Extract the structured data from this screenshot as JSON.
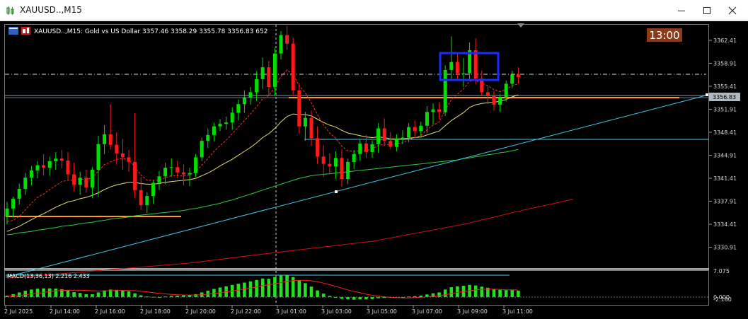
{
  "window": {
    "title": "XAUUSD..,M15",
    "buttons": {
      "minimize": "minimize-icon",
      "maximize": "maximize-icon",
      "close": "close-icon"
    }
  },
  "chart": {
    "info_line": "XAUUSD..,M15:  Gold vs US Dollar  3357.46 3358.29 3355.78 3356.83  652",
    "timer": "13:00",
    "current_price_label": "3356.83",
    "colors": {
      "bull": "#00e000",
      "bear": "#ff1a1a",
      "ma_fast": "#ff3030",
      "ma_slow": "#e8e070",
      "ma_green": "#2ecc40",
      "ma_red": "#d01010",
      "trend": "#40c8e8",
      "orange": "#ff9a1a",
      "box": "#1a2cff",
      "timer_bg": "#8b3a1a"
    }
  },
  "chart_data": {
    "type": "candlestick",
    "price_ticks": [
      "3362.41",
      "3358.91",
      "3355.41",
      "3351.91",
      "3348.41",
      "3344.91",
      "3341.41",
      "3337.91",
      "3334.41",
      "3330.91"
    ],
    "macd_label": "MACD(13,36,13) 2.216 2.433",
    "macd_ticks": [
      "7.075",
      "0.000",
      "-2.180"
    ],
    "time_labels": [
      "2 Jul 2025",
      "2 Jul 14:00",
      "2 Jul 16:00",
      "2 Jul 18:00",
      "2 Jul 20:00",
      "2 Jul 22:00",
      "3 Jul 01:00",
      "3 Jul 03:00",
      "3 Jul 05:00",
      "3 Jul 07:00",
      "3 Jul 09:00",
      "3 Jul 11:00"
    ],
    "ohlc": [
      [
        3335.6,
        3337.8,
        3334.4,
        3336.8
      ],
      [
        3336.8,
        3338.6,
        3335.4,
        3338.3
      ],
      [
        3338.3,
        3340.6,
        3337.4,
        3339.8
      ],
      [
        3339.8,
        3342.2,
        3338.9,
        3341.5
      ],
      [
        3341.5,
        3343.3,
        3340.3,
        3342.6
      ],
      [
        3342.6,
        3344.0,
        3341.4,
        3343.4
      ],
      [
        3343.4,
        3345.1,
        3341.8,
        3343.0
      ],
      [
        3343.0,
        3344.7,
        3341.8,
        3344.0
      ],
      [
        3344.0,
        3345.4,
        3342.7,
        3344.4
      ],
      [
        3344.4,
        3345.7,
        3342.9,
        3344.1
      ],
      [
        3344.1,
        3345.4,
        3341.2,
        3342.0
      ],
      [
        3342.0,
        3343.8,
        3339.4,
        3340.4
      ],
      [
        3340.4,
        3342.4,
        3338.9,
        3341.5
      ],
      [
        3341.5,
        3342.7,
        3339.2,
        3340.0
      ],
      [
        3340.0,
        3343.1,
        3338.4,
        3342.7
      ],
      [
        3342.7,
        3347.9,
        3338.6,
        3346.6
      ],
      [
        3346.6,
        3349.5,
        3345.1,
        3348.1
      ],
      [
        3348.1,
        3352.7,
        3345.8,
        3346.5
      ],
      [
        3346.5,
        3348.4,
        3343.5,
        3345.2
      ],
      [
        3345.2,
        3347.4,
        3342.7,
        3344.6
      ],
      [
        3344.6,
        3345.7,
        3342.4,
        3343.9
      ],
      [
        3343.9,
        3351.3,
        3338.4,
        3339.6
      ],
      [
        3339.6,
        3341.6,
        3336.6,
        3337.3
      ],
      [
        3337.3,
        3339.3,
        3336.1,
        3338.7
      ],
      [
        3338.7,
        3341.1,
        3337.5,
        3340.7
      ],
      [
        3340.7,
        3342.5,
        3339.6,
        3341.7
      ],
      [
        3341.7,
        3343.8,
        3340.5,
        3343.0
      ],
      [
        3343.0,
        3344.4,
        3341.6,
        3343.1
      ],
      [
        3343.1,
        3344.1,
        3341.4,
        3342.3
      ],
      [
        3342.3,
        3343.5,
        3340.3,
        3342.0
      ],
      [
        3342.0,
        3343.0,
        3340.2,
        3342.2
      ],
      [
        3342.2,
        3345.1,
        3341.6,
        3344.6
      ],
      [
        3344.6,
        3347.6,
        3344.0,
        3347.1
      ],
      [
        3347.1,
        3349.0,
        3346.0,
        3348.0
      ],
      [
        3348.0,
        3349.9,
        3347.0,
        3349.3
      ],
      [
        3349.3,
        3350.4,
        3348.6,
        3349.7
      ],
      [
        3349.7,
        3350.8,
        3348.8,
        3349.9
      ],
      [
        3349.9,
        3352.2,
        3348.8,
        3351.4
      ],
      [
        3351.4,
        3353.4,
        3350.2,
        3352.7
      ],
      [
        3352.7,
        3354.8,
        3351.4,
        3353.7
      ],
      [
        3353.7,
        3355.3,
        3352.6,
        3354.5
      ],
      [
        3354.5,
        3357.7,
        3353.2,
        3356.5
      ],
      [
        3356.5,
        3359.8,
        3355.0,
        3358.3
      ],
      [
        3358.3,
        3359.3,
        3354.0,
        3355.3
      ],
      [
        3355.3,
        3361.3,
        3354.0,
        3360.4
      ],
      [
        3360.4,
        3363.8,
        3359.5,
        3363.2
      ],
      [
        3363.2,
        3364.6,
        3361.0,
        3361.9
      ],
      [
        3361.9,
        3362.8,
        3354.0,
        3354.8
      ],
      [
        3354.8,
        3355.9,
        3348.2,
        3349.3
      ],
      [
        3349.3,
        3351.5,
        3347.1,
        3350.6
      ],
      [
        3350.6,
        3351.7,
        3346.3,
        3347.5
      ],
      [
        3347.5,
        3349.3,
        3343.6,
        3344.7
      ],
      [
        3344.7,
        3346.4,
        3341.6,
        3343.6
      ],
      [
        3343.6,
        3345.2,
        3342.0,
        3343.2
      ],
      [
        3343.2,
        3345.5,
        3341.3,
        3344.5
      ],
      [
        3344.5,
        3345.8,
        3340.1,
        3341.3
      ],
      [
        3341.3,
        3344.4,
        3340.5,
        3343.9
      ],
      [
        3343.9,
        3345.7,
        3342.8,
        3345.1
      ],
      [
        3345.1,
        3347.3,
        3344.1,
        3346.7
      ],
      [
        3346.7,
        3348.0,
        3344.5,
        3345.4
      ],
      [
        3345.4,
        3347.2,
        3344.5,
        3346.6
      ],
      [
        3346.6,
        3349.8,
        3345.3,
        3349.0
      ],
      [
        3349.0,
        3350.5,
        3346.3,
        3347.1
      ],
      [
        3347.1,
        3348.4,
        3345.8,
        3346.2
      ],
      [
        3346.2,
        3348.1,
        3345.5,
        3347.4
      ],
      [
        3347.4,
        3348.7,
        3346.6,
        3347.6
      ],
      [
        3347.6,
        3349.8,
        3346.9,
        3349.2
      ],
      [
        3349.2,
        3350.2,
        3347.7,
        3348.6
      ],
      [
        3348.6,
        3350.0,
        3347.6,
        3349.4
      ],
      [
        3349.4,
        3352.4,
        3348.3,
        3351.5
      ],
      [
        3351.5,
        3352.8,
        3349.6,
        3351.9
      ],
      [
        3351.9,
        3353.0,
        3350.4,
        3351.5
      ],
      [
        3351.5,
        3358.6,
        3350.9,
        3357.9
      ],
      [
        3357.9,
        3363.0,
        3356.4,
        3359.1
      ],
      [
        3359.1,
        3360.4,
        3356.4,
        3357.4
      ],
      [
        3357.4,
        3359.7,
        3355.3,
        3357.4
      ],
      [
        3357.4,
        3362.1,
        3356.3,
        3360.9
      ],
      [
        3360.9,
        3362.7,
        3355.7,
        3356.6
      ],
      [
        3356.6,
        3357.8,
        3353.9,
        3354.5
      ],
      [
        3354.5,
        3355.4,
        3352.7,
        3353.9
      ],
      [
        3353.9,
        3354.7,
        3351.7,
        3352.6
      ],
      [
        3352.6,
        3354.2,
        3351.5,
        3353.7
      ],
      [
        3353.7,
        3356.3,
        3353.1,
        3355.8
      ],
      [
        3355.8,
        3357.8,
        3355.1,
        3357.2
      ],
      [
        3357.2,
        3358.3,
        3355.8,
        3356.8
      ]
    ],
    "ma_fast": [
      3334.8,
      3335.0,
      3335.6,
      3336.6,
      3337.6,
      3338.5,
      3339.0,
      3339.7,
      3340.3,
      3340.9,
      3341.1,
      3341.1,
      3341.3,
      3341.2,
      3341.5,
      3342.5,
      3343.5,
      3343.9,
      3344.3,
      3344.4,
      3344.3,
      3343.1,
      3341.9,
      3341.1,
      3341.1,
      3341.1,
      3341.5,
      3341.8,
      3341.8,
      3341.8,
      3341.9,
      3342.5,
      3343.4,
      3344.4,
      3345.5,
      3346.4,
      3347.2,
      3348.2,
      3349.2,
      3350.2,
      3351.2,
      3352.3,
      3353.5,
      3354.0,
      3355.3,
      3356.9,
      3357.9,
      3357.2,
      3355.5,
      3354.4,
      3352.9,
      3351.1,
      3349.5,
      3348.3,
      3347.5,
      3346.3,
      3345.6,
      3345.5,
      3345.6,
      3345.6,
      3345.9,
      3346.4,
      3346.6,
      3346.5,
      3346.7,
      3346.8,
      3347.3,
      3347.6,
      3347.9,
      3348.8,
      3349.5,
      3350.0,
      3351.8,
      3353.4,
      3354.2,
      3355.0,
      3356.2,
      3356.3,
      3355.9,
      3355.5,
      3354.9,
      3354.6,
      3354.9,
      3355.5,
      3355.8
    ],
    "ma_slow": [
      3333.3,
      3333.7,
      3334.1,
      3334.6,
      3335.1,
      3335.6,
      3336.0,
      3336.5,
      3337.0,
      3337.4,
      3337.8,
      3338.0,
      3338.3,
      3338.5,
      3338.8,
      3339.2,
      3339.7,
      3340.1,
      3340.4,
      3340.6,
      3340.8,
      3340.8,
      3340.6,
      3340.5,
      3340.5,
      3340.6,
      3340.8,
      3340.9,
      3341.0,
      3341.1,
      3341.2,
      3341.4,
      3341.8,
      3342.2,
      3342.7,
      3343.3,
      3343.8,
      3344.3,
      3344.9,
      3345.5,
      3346.1,
      3346.8,
      3347.6,
      3348.2,
      3349.0,
      3350.0,
      3350.8,
      3351.2,
      3351.1,
      3351.1,
      3350.9,
      3350.4,
      3349.9,
      3349.5,
      3349.2,
      3348.7,
      3348.3,
      3348.1,
      3347.9,
      3347.7,
      3347.6,
      3347.7,
      3347.6,
      3347.4,
      3347.4,
      3347.4,
      3347.5,
      3347.6,
      3347.7,
      3348.0,
      3348.3,
      3348.6,
      3349.4,
      3350.2,
      3350.8,
      3351.4,
      3352.2,
      3352.6,
      3352.8,
      3352.9,
      3353.0,
      3353.1,
      3353.4,
      3353.8,
      3354.1
    ],
    "ma_green": [
      3332.8,
      3332.9,
      3333.1,
      3333.2,
      3333.3,
      3333.5,
      3333.6,
      3333.8,
      3333.9,
      3334.1,
      3334.2,
      3334.3,
      3334.5,
      3334.6,
      3334.7,
      3334.9,
      3335.0,
      3335.2,
      3335.3,
      3335.4,
      3335.5,
      3335.7,
      3335.8,
      3335.9,
      3336.0,
      3336.1,
      3336.2,
      3336.3,
      3336.4,
      3336.5,
      3336.7,
      3336.8,
      3337.0,
      3337.2,
      3337.4,
      3337.6,
      3337.9,
      3338.1,
      3338.4,
      3338.7,
      3339.0,
      3339.3,
      3339.6,
      3339.9,
      3340.2,
      3340.5,
      3340.8,
      3341.1,
      3341.4,
      3341.6,
      3341.8,
      3341.9,
      3342.0,
      3342.1,
      3342.2,
      3342.3,
      3342.4,
      3342.5,
      3342.6,
      3342.7,
      3342.8,
      3342.9,
      3343.0,
      3343.1,
      3343.2,
      3343.3,
      3343.4,
      3343.5,
      3343.6,
      3343.7,
      3343.8,
      3343.9,
      3344.0,
      3344.1,
      3344.2,
      3344.4,
      3344.5,
      3344.7,
      3344.8,
      3345.0,
      3345.1,
      3345.3,
      3345.4,
      3345.6,
      3345.8
    ],
    "ma_red_line": [
      [
        0,
        3326.2
      ],
      [
        30,
        3328.5
      ],
      [
        45,
        3330.2
      ],
      [
        60,
        3331.8
      ],
      [
        75,
        3334.4
      ],
      [
        85,
        3336.6
      ],
      [
        93,
        3338.2
      ]
    ],
    "macd": [
      0.5,
      1.0,
      1.6,
      2.2,
      2.6,
      2.9,
      3.0,
      3.0,
      2.9,
      2.7,
      2.3,
      1.7,
      1.4,
      1.0,
      1.0,
      1.6,
      2.3,
      2.6,
      2.5,
      2.3,
      2.0,
      1.3,
      0.6,
      0.2,
      0.1,
      0.0,
      0.2,
      0.4,
      0.5,
      0.6,
      0.7,
      1.0,
      1.6,
      2.2,
      2.8,
      3.3,
      3.7,
      4.2,
      4.6,
      5.0,
      5.4,
      5.9,
      6.4,
      6.3,
      6.9,
      7.4,
      7.5,
      6.9,
      5.7,
      4.8,
      3.6,
      2.3,
      1.2,
      0.4,
      -0.1,
      -0.6,
      -0.8,
      -0.9,
      -0.8,
      -0.8,
      -0.7,
      -0.4,
      -0.3,
      -0.2,
      -0.1,
      0.0,
      0.2,
      0.3,
      0.5,
      0.9,
      1.3,
      1.6,
      2.6,
      3.4,
      3.7,
      3.9,
      4.2,
      4.0,
      3.6,
      3.2,
      2.8,
      2.5,
      2.4,
      2.4,
      2.2
    ],
    "macd_signal": [
      0.3,
      0.4,
      0.5,
      0.8,
      1.1,
      1.3,
      1.6,
      1.9,
      2.1,
      2.3,
      2.4,
      2.4,
      2.4,
      2.3,
      2.2,
      2.1,
      2.1,
      2.2,
      2.3,
      2.3,
      2.3,
      2.2,
      2.0,
      1.8,
      1.5,
      1.3,
      1.1,
      0.9,
      0.8,
      0.7,
      0.7,
      0.7,
      0.8,
      1.0,
      1.2,
      1.5,
      1.8,
      2.1,
      2.4,
      2.8,
      3.1,
      3.5,
      3.9,
      4.3,
      4.6,
      5.0,
      5.4,
      5.7,
      5.8,
      5.8,
      5.6,
      5.3,
      4.8,
      4.3,
      3.7,
      3.1,
      2.5,
      1.9,
      1.5,
      1.0,
      0.6,
      0.3,
      0.1,
      -0.1,
      -0.2,
      -0.3,
      -0.3,
      -0.2,
      -0.1,
      0.1,
      0.3,
      0.5,
      0.8,
      1.2,
      1.6,
      1.9,
      2.2,
      2.5,
      2.6,
      2.7,
      2.7,
      2.6,
      2.5,
      2.5,
      2.4
    ]
  }
}
